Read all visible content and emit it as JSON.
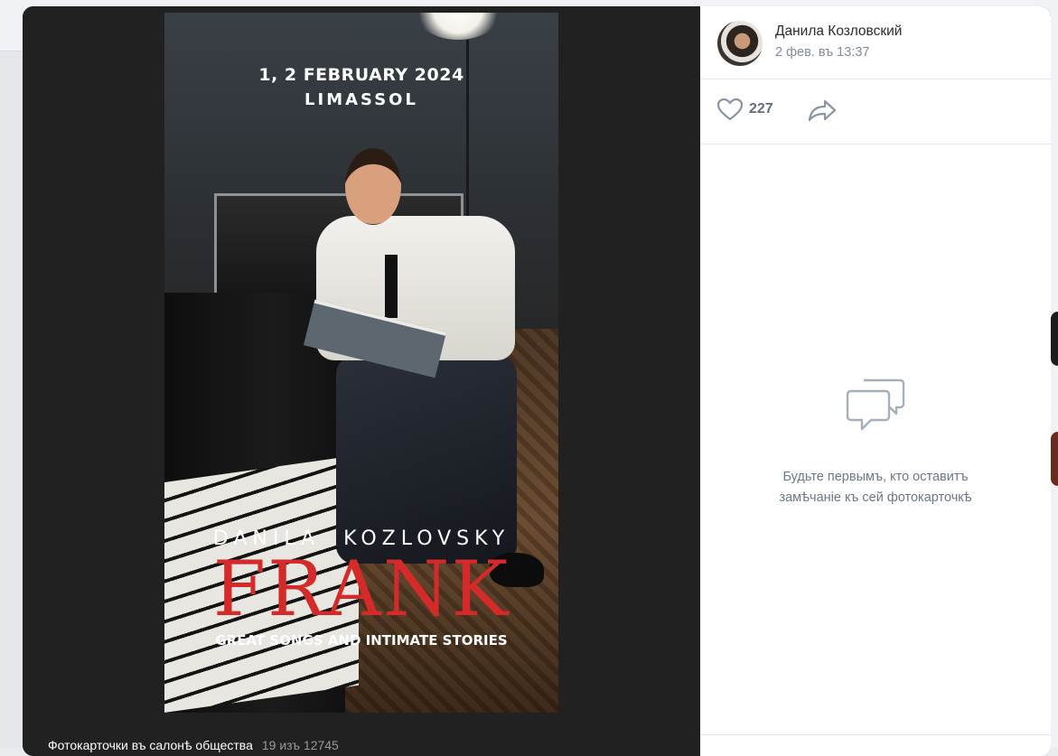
{
  "poster": {
    "date_line": "1, 2 FEBRUARY 2024",
    "city": "LIMASSOL",
    "artist": "DANILA  KOZLOVSKY",
    "title": "FRANK",
    "tagline": "GREAT SONGS AND INTIMATE STORIES"
  },
  "caption": {
    "album": "Фотокарточки въ салонѣ общества",
    "position": "19 изъ 12745"
  },
  "author": {
    "name": "Данила Козловский",
    "date": "2 фев. въ 13:37"
  },
  "actions": {
    "likes": "227",
    "like_icon": "heart-icon",
    "share_icon": "share-arrow-icon"
  },
  "comments": {
    "empty_text": "Будьте первымъ, кто оставитъ замѣчаніе къ сей фотокарточкѣ",
    "icon": "comment-bubbles-icon"
  },
  "colors": {
    "viewer_bg": "#222222",
    "panel_bg": "#ffffff",
    "title_red": "#d42a2a",
    "muted_text": "#818c99"
  }
}
